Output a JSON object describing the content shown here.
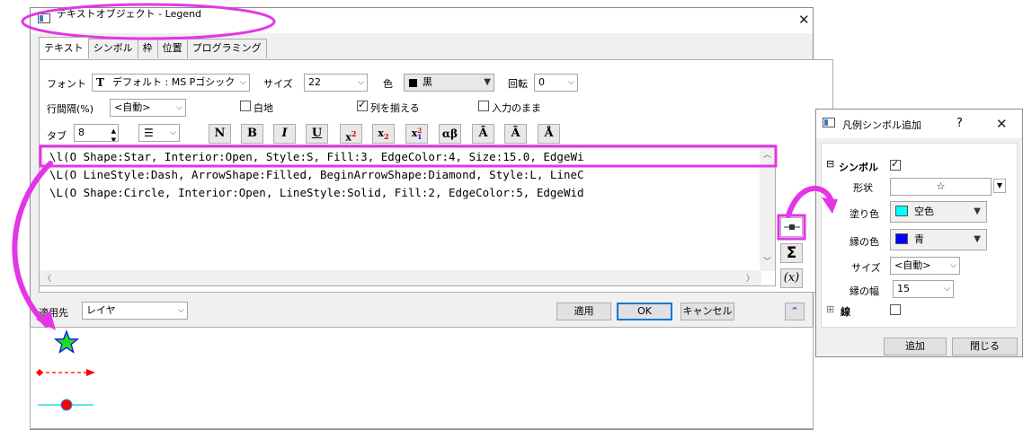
{
  "main_dialog": {
    "title": "テキストオブジェクト - Legend",
    "close_glyph": "✕",
    "tabs": [
      "テキスト",
      "シンボル",
      "枠",
      "位置",
      "プログラミング"
    ],
    "font_label": "フォント",
    "font_value": "デフォルト : MS Pゴシック",
    "size_label": "サイズ",
    "size_value": "22",
    "color_label": "色",
    "color_value": "黒",
    "rotation_label": "回転",
    "rotation_value": "0",
    "line_spacing_label": "行間隔(%)",
    "line_spacing_value": "<自動>",
    "white_bg_label": "白地",
    "align_columns_label": "列を揃える",
    "as_typed_label": "入力のまま",
    "tab_label": "タブ",
    "tab_value": "8",
    "format_buttons": [
      "N",
      "B",
      "I",
      "U",
      "x2",
      "x2",
      "x12",
      "αβ",
      "Ā",
      "Ã",
      "Å"
    ],
    "code_lines": [
      "\\l(O Shape:Star, Interior:Open, Style:S, Fill:3, EdgeColor:4, Size:15.0, EdgeWi",
      "\\L(O LineStyle:Dash, ArrowShape:Filled, BeginArrowShape:Diamond, Style:L, LineC",
      "\\L(O Shape:Circle, Interior:Open, LineStyle:Solid, Fill:2, EdgeColor:5, EdgeWid"
    ],
    "apply_to_label": "適用先",
    "apply_to_value": "レイヤ",
    "apply_button": "適用",
    "ok_button": "OK",
    "cancel_button": "キャンセル"
  },
  "symbol_dialog": {
    "title": "凡例シンボル追加",
    "help_glyph": "?",
    "close_glyph": "✕",
    "symbol_section": "シンボル",
    "shape_label": "形状",
    "shape_value": "☆",
    "fill_color_label": "塗り色",
    "fill_color_value": "空色",
    "edge_color_label": "縁の色",
    "edge_color_value": "青",
    "size_label": "サイズ",
    "size_value": "<自動>",
    "edge_width_label": "縁の幅",
    "edge_width_value": "15",
    "line_section": "線",
    "add_button": "追加",
    "close_button": "閉じる"
  },
  "colors": {
    "highlight": "#e335e6",
    "star_fill": "#22dd22",
    "arrow_line": "#ff0000",
    "circle_fill": "#ff0000",
    "circle_line": "#00d0d0",
    "fill_swatch": "#00ffff",
    "edge_swatch": "#0000ff",
    "ok_border": "#0078d7"
  }
}
